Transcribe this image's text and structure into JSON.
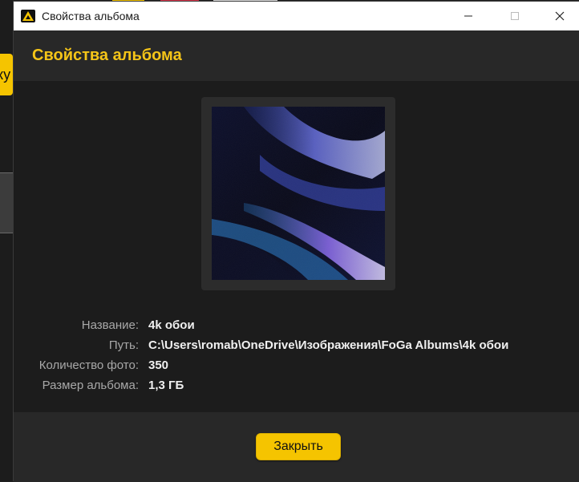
{
  "background_app": {
    "partial_button_text": "ку"
  },
  "window": {
    "title": "Свойства альбома",
    "controls": {
      "minimize": "minimize-icon",
      "maximize": "maximize-icon",
      "close": "close-icon"
    }
  },
  "dialog": {
    "heading": "Свойства альбома",
    "properties": [
      {
        "label": "Название:",
        "value": "4k обои"
      },
      {
        "label": "Путь:",
        "value": "C:\\Users\\romab\\OneDrive\\Изображения\\FoGa Albums\\4k обои"
      },
      {
        "label": "Количество фото:",
        "value": "350"
      },
      {
        "label": "Размер альбома:",
        "value": "1,3 ГБ"
      }
    ],
    "close_button": "Закрыть"
  },
  "colors": {
    "accent": "#f5c518",
    "button": "#f5c400",
    "dialog_bg": "#1c1c1c",
    "panel_bg": "#282828"
  }
}
